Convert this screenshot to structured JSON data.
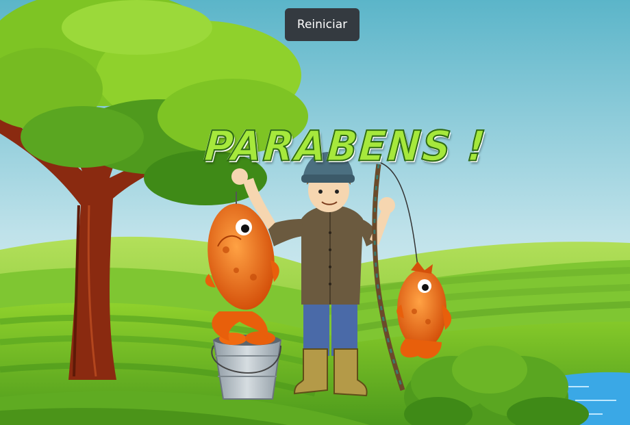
{
  "controls": {
    "restart_label": "Reiniciar"
  },
  "message": {
    "text": "PARABENS !"
  },
  "colors": {
    "sky_top": "#5bb5c9",
    "sky_bottom": "#e6f4f6",
    "grass_light": "#8fd12c",
    "grass_dark": "#4c9a1c",
    "tree_trunk": "#8a2a10",
    "fish": "#f06a10",
    "water": "#3aa8e6",
    "button_bg": "#343a40",
    "message_fill": "#a6e83c"
  },
  "icons": [
    "tree",
    "fisherman",
    "fish",
    "bucket",
    "fishing-rod",
    "bush",
    "pond"
  ]
}
